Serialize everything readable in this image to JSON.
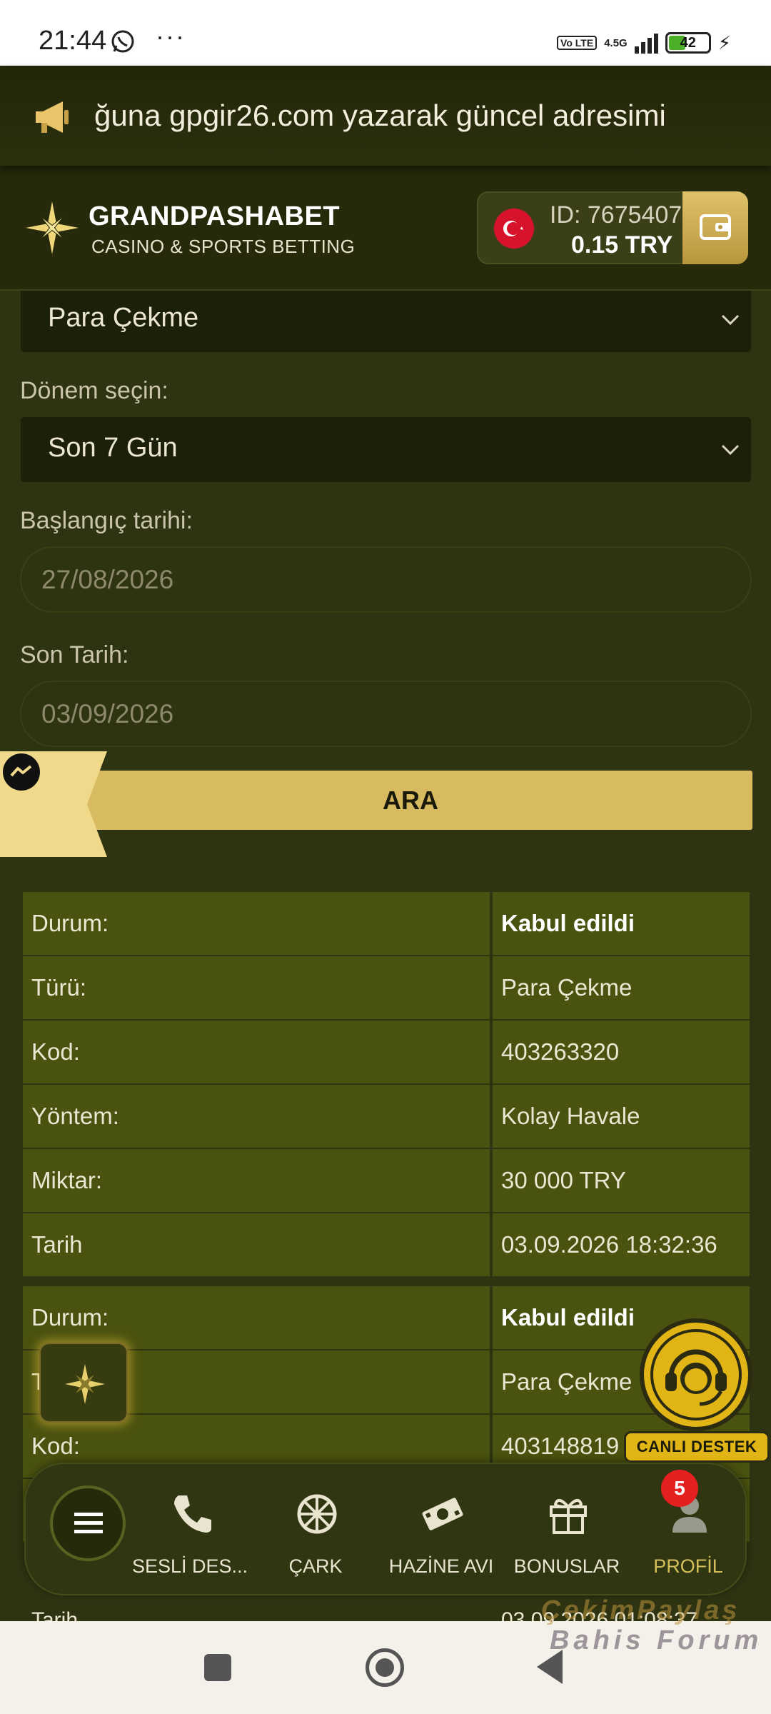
{
  "status_bar": {
    "time": "21:44",
    "more": "···",
    "volte": "Vo LTE",
    "network": "4.5G",
    "battery": "42"
  },
  "marquee": {
    "text": "ğuna gpgir26.com yazarak güncel adresimi"
  },
  "header": {
    "brand_title": "GRANDPASHABET",
    "brand_subtitle": "CASINO & SPORTS BETTING",
    "account_id": "ID: 7675407",
    "balance": "0.15   TRY"
  },
  "form": {
    "type_value": "Para Çekme",
    "period_label": "Dönem seçin:",
    "period_value": "Son 7 Gün",
    "start_label": "Başlangıç tarihi:",
    "start_value": "27/08/2026",
    "end_label": "Son Tarih:",
    "end_value": "03/09/2026",
    "search_button": "ARA"
  },
  "transactions": [
    {
      "rows": [
        {
          "key": "Durum:",
          "value": "Kabul edildi",
          "bold": true
        },
        {
          "key": "Türü:",
          "value": "Para Çekme"
        },
        {
          "key": "Kod:",
          "value": "403263320"
        },
        {
          "key": "Yöntem:",
          "value": "Kolay Havale"
        },
        {
          "key": "Miktar:",
          "value": "30 000 TRY"
        },
        {
          "key": "Tarih",
          "value": "03.09.2026 18:32:36"
        }
      ]
    },
    {
      "rows": [
        {
          "key": "Durum:",
          "value": "Kabul edildi",
          "bold": true
        },
        {
          "key": "Türü:",
          "value": "Para Çekme"
        },
        {
          "key": "Kod:",
          "value": "403148819"
        }
      ]
    }
  ],
  "partial_row": {
    "key": "Tarih",
    "value": "03.09.2026 01:08:37"
  },
  "live_support": {
    "label": "CANLI DESTEK"
  },
  "bottom_nav": {
    "items": [
      {
        "label": "SESLİ DES...",
        "icon": "phone-icon"
      },
      {
        "label": "ÇARK",
        "icon": "wheel-icon"
      },
      {
        "label": "HAZİNE AVI",
        "icon": "money-icon"
      },
      {
        "label": "BONUSLAR",
        "icon": "gift-icon"
      },
      {
        "label": "PROFİL",
        "icon": "user-icon"
      }
    ],
    "profile_badge": "5"
  },
  "watermark": {
    "line1": "ÇekimPaylaş",
    "line2": "Bahis Forum"
  },
  "colors": {
    "accent": "#d8bb60",
    "background": "#2e3312",
    "row": "#4a520f",
    "badge": "#e52020"
  }
}
